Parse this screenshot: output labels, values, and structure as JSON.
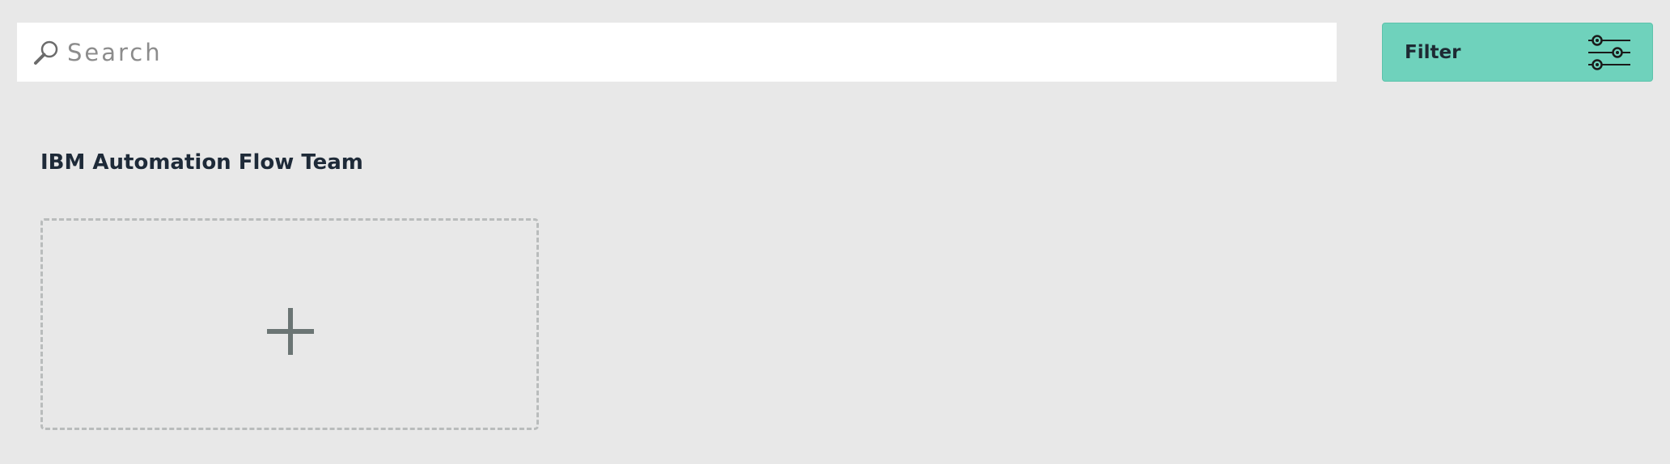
{
  "search": {
    "placeholder": "Search",
    "value": ""
  },
  "filter": {
    "label": "Filter",
    "icon": "sliders-icon"
  },
  "team": {
    "title": "IBM Automation Flow Team",
    "add_tile_icon": "plus-icon"
  },
  "colors": {
    "background": "#e8e8e8",
    "filter_button": "#6fd2bc",
    "title_text": "#1e2a38",
    "dashed_border": "#b9bcbc",
    "plus": "#6b7574"
  }
}
